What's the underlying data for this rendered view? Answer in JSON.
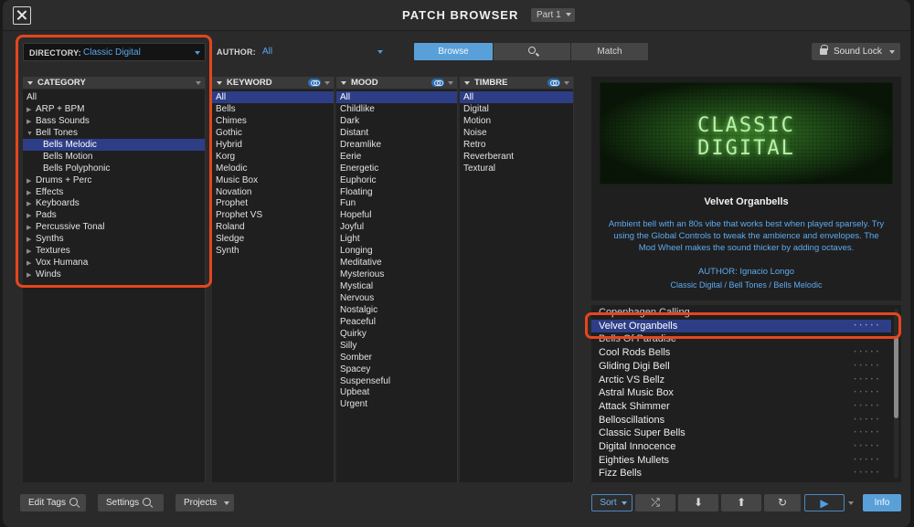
{
  "window": {
    "title": "PATCH BROWSER",
    "part_selector": "Part 1"
  },
  "filters": {
    "directory_label": "DIRECTORY:",
    "directory_value": "Classic Digital",
    "author_label": "AUTHOR:",
    "author_value": "All"
  },
  "modes": {
    "browse": "Browse",
    "match": "Match",
    "active": "Browse"
  },
  "sound_lock": "Sound Lock",
  "columns": {
    "category": {
      "header": "CATEGORY",
      "items": [
        {
          "label": "All",
          "type": "plain"
        },
        {
          "label": "ARP + BPM",
          "type": "collapsed"
        },
        {
          "label": "Bass Sounds",
          "type": "collapsed"
        },
        {
          "label": "Bell Tones",
          "type": "expanded"
        },
        {
          "label": "Bells Melodic",
          "type": "child",
          "selected": true
        },
        {
          "label": "Bells Motion",
          "type": "child"
        },
        {
          "label": "Bells Polyphonic",
          "type": "child"
        },
        {
          "label": "Drums + Perc",
          "type": "collapsed"
        },
        {
          "label": "Effects",
          "type": "collapsed"
        },
        {
          "label": "Keyboards",
          "type": "collapsed"
        },
        {
          "label": "Pads",
          "type": "collapsed"
        },
        {
          "label": "Percussive Tonal",
          "type": "collapsed"
        },
        {
          "label": "Synths",
          "type": "collapsed"
        },
        {
          "label": "Textures",
          "type": "collapsed"
        },
        {
          "label": "Vox Humana",
          "type": "collapsed"
        },
        {
          "label": "Winds",
          "type": "collapsed"
        }
      ]
    },
    "keyword": {
      "header": "KEYWORD",
      "items": [
        "All",
        "Bells",
        "Chimes",
        "Gothic",
        "Hybrid",
        "Korg",
        "Melodic",
        "Music Box",
        "Novation",
        "Prophet",
        "Prophet VS",
        "Roland",
        "Sledge",
        "Synth"
      ],
      "selected": "All"
    },
    "mood": {
      "header": "MOOD",
      "items": [
        "All",
        "Childlike",
        "Dark",
        "Distant",
        "Dreamlike",
        "Eerie",
        "Energetic",
        "Euphoric",
        "Floating",
        "Fun",
        "Hopeful",
        "Joyful",
        "Light",
        "Longing",
        "Meditative",
        "Mysterious",
        "Mystical",
        "Nervous",
        "Nostalgic",
        "Peaceful",
        "Quirky",
        "Silly",
        "Somber",
        "Spacey",
        "Suspenseful",
        "Upbeat",
        "Urgent"
      ],
      "selected": "All"
    },
    "timbre": {
      "header": "TIMBRE",
      "items": [
        "All",
        "Digital",
        "Motion",
        "Noise",
        "Retro",
        "Reverberant",
        "Textural"
      ],
      "selected": "All"
    }
  },
  "patch_info": {
    "art_text": "CLASSIC\nDIGITAL",
    "name": "Velvet Organbells",
    "description": "Ambient bell with an 80s vibe that works best when played sparsely. Try using the Global Controls to tweak the ambience and envelopes. The Mod Wheel makes the sound thicker by adding octaves.",
    "author": "AUTHOR: Ignacio Longo",
    "path": "Classic Digital / Bell Tones / Bells Melodic"
  },
  "results": {
    "items": [
      {
        "name": "Copenhagen Calling",
        "partial": true
      },
      {
        "name": "Velvet Organbells",
        "selected": true
      },
      {
        "name": "Bells Of Paradise",
        "partial": true
      },
      {
        "name": "Cool Rods Bells"
      },
      {
        "name": "Gliding Digi Bell"
      },
      {
        "name": "Arctic VS Bellz"
      },
      {
        "name": "Astral Music Box"
      },
      {
        "name": "Attack Shimmer"
      },
      {
        "name": "Belloscillations"
      },
      {
        "name": "Classic Super Bells"
      },
      {
        "name": "Digital Innocence"
      },
      {
        "name": "Eighties Mullets"
      },
      {
        "name": "Fizz Bells"
      }
    ],
    "rating_dots": "•••••"
  },
  "bottom_bar": {
    "edit_tags": "Edit Tags",
    "settings": "Settings",
    "projects": "Projects",
    "sort": "Sort",
    "info": "Info"
  },
  "icons": {
    "shuffle": "⤮",
    "down": "⬇",
    "up": "⬆",
    "refresh": "↻",
    "play": "▶"
  },
  "colors": {
    "accent_blue": "#5aa0d8",
    "selection": "#2d3d86",
    "link_text": "#5eaaf0",
    "highlight_annotation": "#e4461f"
  }
}
